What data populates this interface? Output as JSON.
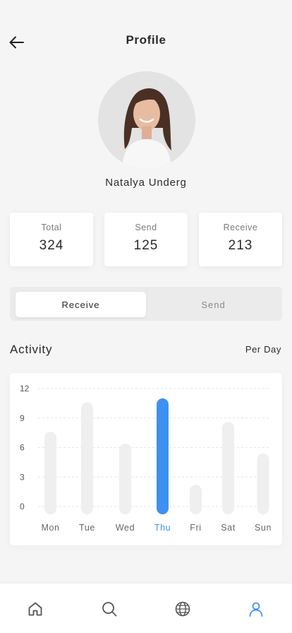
{
  "header": {
    "title": "Profile",
    "back_icon": "arrow-left-icon"
  },
  "user": {
    "name": "Natalya Underg"
  },
  "stats": [
    {
      "label": "Total",
      "value": "324"
    },
    {
      "label": "Send",
      "value": "125"
    },
    {
      "label": "Receive",
      "value": "213"
    }
  ],
  "segment": {
    "active_label": "Receive",
    "inactive_label": "Send"
  },
  "activity": {
    "title": "Activity",
    "period": "Per Day"
  },
  "colors": {
    "accent": "#3d91f0",
    "bar_inactive": "#efefef",
    "nav_inactive": "#555555"
  },
  "chart_data": {
    "type": "bar",
    "categories": [
      "Mon",
      "Tue",
      "Wed",
      "Thu",
      "Fri",
      "Sat",
      "Sun"
    ],
    "values": [
      7.6,
      10.6,
      6.4,
      11.0,
      2.2,
      8.6,
      5.4
    ],
    "highlight_index": 3,
    "yticks": [
      0,
      3,
      6,
      9,
      12
    ],
    "ylim": [
      0,
      12
    ],
    "grid": true,
    "title": "",
    "xlabel": "",
    "ylabel": ""
  },
  "nav": [
    {
      "name": "home",
      "icon": "home-icon",
      "active": false
    },
    {
      "name": "search",
      "icon": "search-icon",
      "active": false
    },
    {
      "name": "explore",
      "icon": "globe-icon",
      "active": false
    },
    {
      "name": "profile",
      "icon": "user-icon",
      "active": true
    }
  ]
}
